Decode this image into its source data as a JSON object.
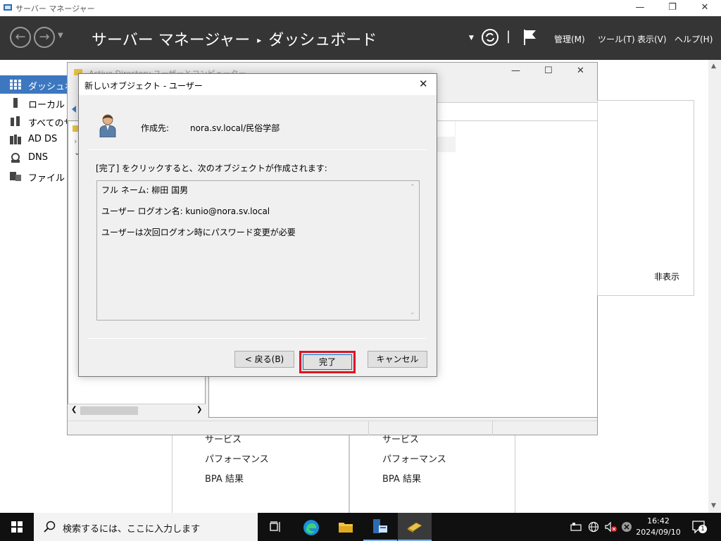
{
  "server_manager": {
    "window_title": "サーバー マネージャー",
    "breadcrumb_root": "サーバー マネージャー",
    "breadcrumb_sep": "▸",
    "breadcrumb_current": "ダッシュボード",
    "menus": [
      "管理(M)",
      "ツール(T)",
      "表示(V)",
      "ヘルプ(H)"
    ],
    "sidebar": [
      {
        "label": "ダッシュボード",
        "icon": "dashboard-grid-icon",
        "active": true
      },
      {
        "label": "ローカル サーバー",
        "icon": "local-server-icon"
      },
      {
        "label": "すべてのサーバー",
        "icon": "all-servers-icon"
      },
      {
        "label": "AD DS",
        "icon": "ad-ds-icon"
      },
      {
        "label": "DNS",
        "icon": "dns-icon"
      },
      {
        "label": "ファイル サービス",
        "icon": "file-services-icon"
      }
    ],
    "hide_label": "非表示",
    "tiles": [
      {
        "links": [
          "サービス",
          "パフォーマンス",
          "BPA 結果"
        ]
      },
      {
        "links": [
          "サービス",
          "パフォーマンス",
          "BPA 結果"
        ]
      }
    ]
  },
  "ad_window": {
    "title": "Active Directory ユーザーとコンピューター"
  },
  "dialog": {
    "title": "新しいオブジェクト - ユーザー",
    "destination_label": "作成先:",
    "destination_value": "nora.sv.local/民俗学部",
    "instruction": "[完了] をクリックすると、次のオブジェクトが作成されます:",
    "summary_lines": [
      "フル ネーム: 柳田 国男",
      "ユーザー ログオン名: kunio@nora.sv.local",
      "ユーザーは次回ログオン時にパスワード変更が必要"
    ],
    "back_button": "< 戻る(B)",
    "finish_button": "完了",
    "cancel_button": "キャンセル"
  },
  "taskbar": {
    "search_placeholder": "検索するには、ここに入力します",
    "time": "16:42",
    "date": "2024/09/10",
    "notification_count": "1"
  },
  "colors": {
    "header_bg": "#353535",
    "sidebar_active": "#3c77c0",
    "highlight_red": "#e0151f",
    "taskbar_bg": "#101010"
  }
}
